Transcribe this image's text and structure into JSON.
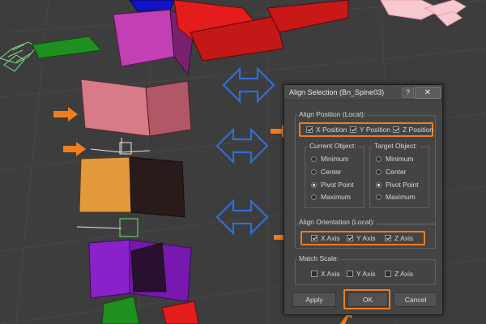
{
  "dialog": {
    "title": "Align Selection (Bn_Spine03)",
    "help_label": "?",
    "close_label": "✕",
    "align_position": {
      "label": "Align Position (Local):",
      "x": {
        "label": "X Position",
        "checked": true
      },
      "y": {
        "label": "Y Position",
        "checked": true
      },
      "z": {
        "label": "Z Position",
        "checked": true
      }
    },
    "current_object": {
      "label": "Current Object:",
      "options": [
        "Minimum",
        "Center",
        "Pivot Point",
        "Maximum"
      ],
      "selected": "Pivot Point"
    },
    "target_object": {
      "label": "Target Object:",
      "options": [
        "Minimum",
        "Center",
        "Pivot Point",
        "Maximum"
      ],
      "selected": "Pivot Point"
    },
    "align_orientation": {
      "label": "Align Orientation (Local):",
      "x": {
        "label": "X Axis",
        "checked": true
      },
      "y": {
        "label": "Y Axis",
        "checked": true
      },
      "z": {
        "label": "Z Axis",
        "checked": true
      }
    },
    "match_scale": {
      "label": "Match Scale:",
      "x": {
        "label": "X Axis",
        "checked": false
      },
      "y": {
        "label": "Y Axis",
        "checked": false
      },
      "z": {
        "label": "Z Axis",
        "checked": false
      }
    },
    "buttons": {
      "apply": "Apply",
      "ok": "OK",
      "cancel": "Cancel"
    }
  },
  "colors": {
    "highlight": "#f07d1f",
    "arrow_blue": "#2f6fd6",
    "bone_pink": "#d77b86",
    "bone_orange": "#e39a3a",
    "bone_purple": "#8b22c9",
    "bone_magenta": "#c33fb4",
    "bone_red": "#e51c1c",
    "bone_green": "#1f8f1f"
  }
}
